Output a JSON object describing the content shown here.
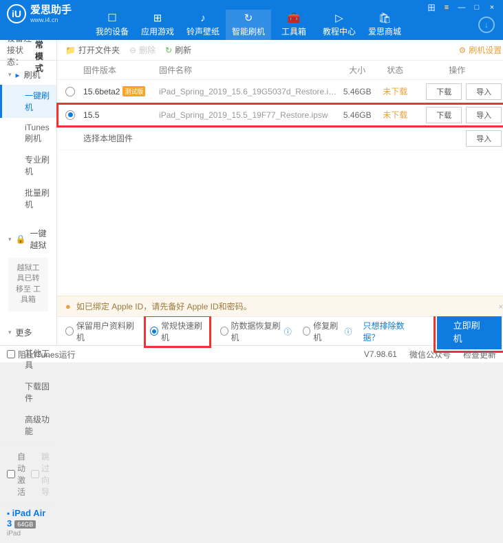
{
  "app": {
    "name_cn": "爱思助手",
    "name_en": "www.i4.cn",
    "logo_letter": "iU"
  },
  "win_controls": [
    "田",
    "≡",
    "—",
    "□",
    "×"
  ],
  "nav": {
    "items": [
      {
        "label": "我的设备",
        "icon": "☐"
      },
      {
        "label": "应用游戏",
        "icon": "⊞"
      },
      {
        "label": "铃声壁纸",
        "icon": "♪"
      },
      {
        "label": "智能刷机",
        "icon": "↻",
        "active": true
      },
      {
        "label": "工具箱",
        "icon": "🧰"
      },
      {
        "label": "教程中心",
        "icon": "▷"
      },
      {
        "label": "爱思商城",
        "icon": "🛍"
      }
    ]
  },
  "sidebar": {
    "conn_label": "设备连接状态：",
    "conn_value": "正常模式",
    "sec1": {
      "title": "刷机",
      "items": [
        "一键刷机",
        "iTunes刷机",
        "专业刷机",
        "批量刷机"
      ],
      "active": 0
    },
    "sec2": {
      "title": "一键越狱",
      "note": "越狱工具已转移至\n工具箱"
    },
    "sec3": {
      "title": "更多",
      "items": [
        "其他工具",
        "下载固件",
        "高级功能"
      ]
    },
    "auto_activate": "自动激活",
    "skip_guide": "跳过向导",
    "device": {
      "name": "iPad Air 3",
      "storage": "64GB",
      "type": "iPad"
    }
  },
  "toolbar": {
    "open": "打开文件夹",
    "delete": "删除",
    "refresh": "刷新",
    "settings": "刷机设置"
  },
  "table": {
    "h_ver": "固件版本",
    "h_name": "固件名称",
    "h_size": "大小",
    "h_status": "状态",
    "h_ops": "操作"
  },
  "rows": [
    {
      "ver": "15.6beta2",
      "beta": "测试版",
      "name": "iPad_Spring_2019_15.6_19G5037d_Restore.i…",
      "size": "5.46GB",
      "status": "未下载",
      "selected": false
    },
    {
      "ver": "15.5",
      "name": "iPad_Spring_2019_15.5_19F77_Restore.ipsw",
      "size": "5.46GB",
      "status": "未下载",
      "selected": true
    }
  ],
  "local_fw": "选择本地固件",
  "btn": {
    "download": "下载",
    "import": "导入"
  },
  "warning": "如已绑定 Apple ID，请先备好 Apple ID和密码。",
  "options": {
    "keep_data": "保留用户资料刷机",
    "normal": "常规快速刷机",
    "recovery": "防数据恢复刷机",
    "repair": "修复刷机",
    "exclude_link": "只想排除数据？",
    "flash_btn": "立即刷机"
  },
  "statusbar": {
    "block": "阻止iTunes运行",
    "version": "V7.98.61",
    "wechat": "微信公众号",
    "update": "检查更新"
  }
}
